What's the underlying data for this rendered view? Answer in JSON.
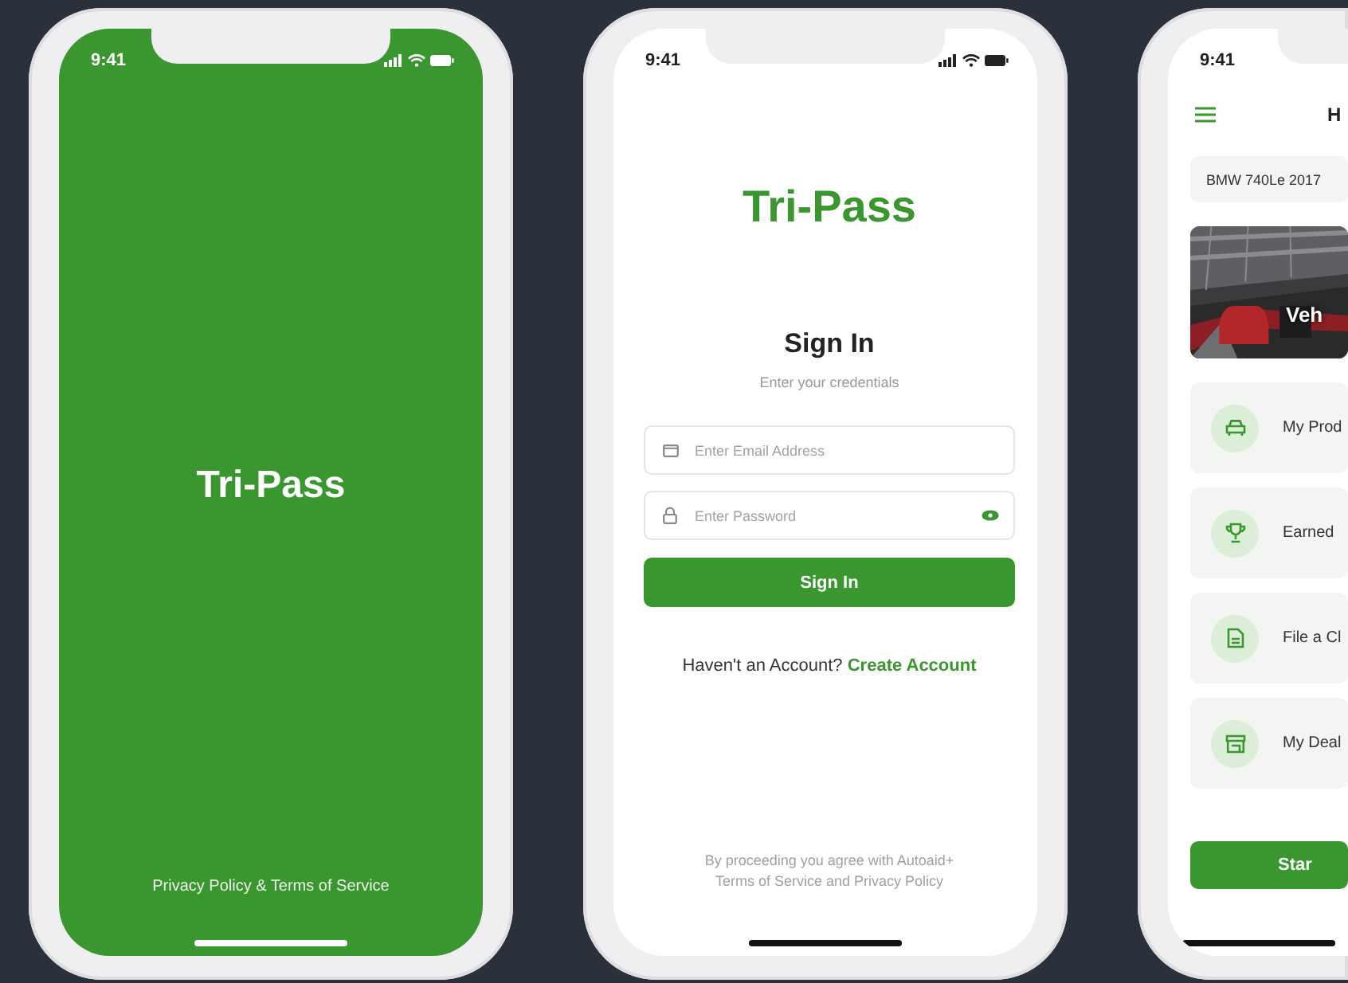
{
  "phones": [
    {
      "kind": "splash",
      "status_time": "9:41",
      "logo": "Tri-Pass",
      "footer_link": "Privacy Policy & Terms of Service"
    },
    {
      "kind": "sign_in",
      "status_time": "9:41",
      "logo": "Tri-Pass",
      "heading": "Sign In",
      "subheading": "Enter your credentials",
      "fields": [
        {
          "kind": "email",
          "placeholder": "Enter Email Address"
        },
        {
          "kind": "password",
          "placeholder": "Enter Password"
        }
      ],
      "button": "Sign In",
      "prompt": "Haven't an Account?",
      "link": "Create Account",
      "footer": "By proceeding you agree with Autoaid+ Terms of Service and Privacy Policy"
    },
    {
      "kind": "home",
      "status_time": "9:41",
      "title": "H",
      "vehicle": "BMW 740Le 2017",
      "banner": {
        "kind": "picture",
        "title": "Veh"
      },
      "menu": [
        {
          "kind": "car",
          "label": "My Prod"
        },
        {
          "kind": "trophy",
          "label": "Earned"
        },
        {
          "kind": "document",
          "label": "File a Cl"
        },
        {
          "kind": "store",
          "label": "My Deal"
        }
      ],
      "button": "Star"
    }
  ]
}
